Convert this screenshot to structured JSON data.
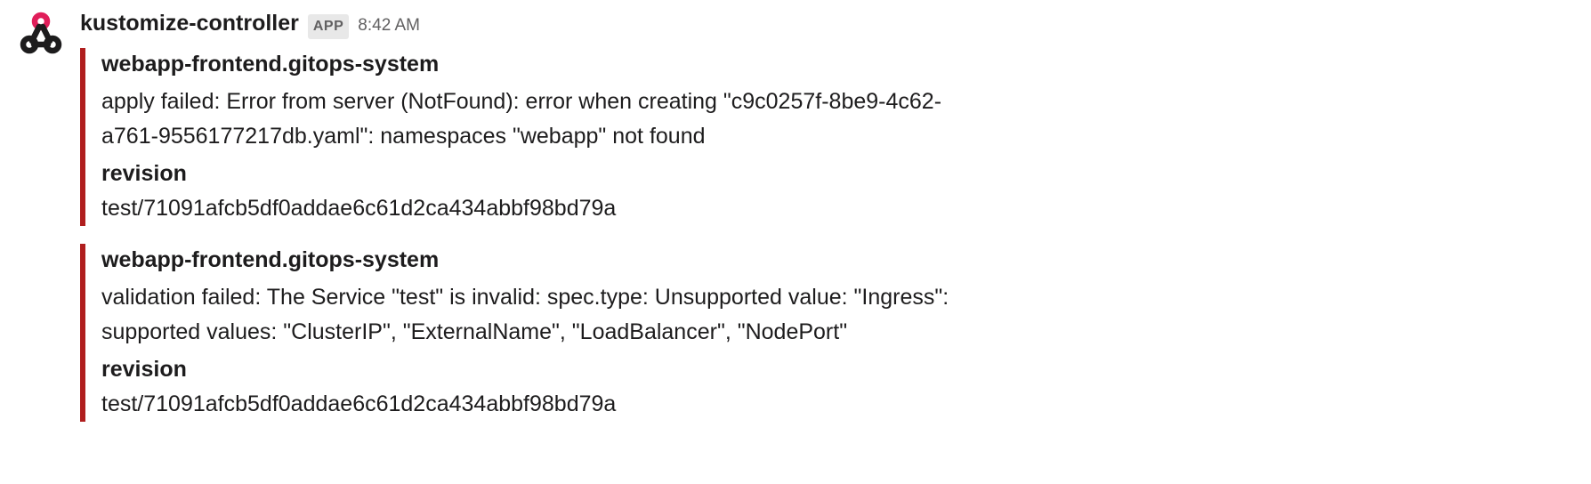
{
  "message": {
    "sender": "kustomize-controller",
    "badge": "APP",
    "timestamp": "8:42 AM"
  },
  "attachments": [
    {
      "title": "webapp-frontend.gitops-system",
      "body": "apply failed: Error from server (NotFound): error when creating \"c9c0257f-8be9-4c62-a761-9556177217db.yaml\": namespaces \"webapp\" not found",
      "field_label": "revision",
      "field_value": "test/71091afcb5df0addae6c61d2ca434abbf98bd79a"
    },
    {
      "title": "webapp-frontend.gitops-system",
      "body": "validation failed: The Service \"test\" is invalid: spec.type: Unsupported value: \"Ingress\": supported values: \"ClusterIP\", \"ExternalName\", \"LoadBalancer\", \"NodePort\"",
      "field_label": "revision",
      "field_value": "test/71091afcb5df0addae6c61d2ca434abbf98bd79a"
    }
  ],
  "colors": {
    "attachment_bar": "#b01e1e"
  }
}
